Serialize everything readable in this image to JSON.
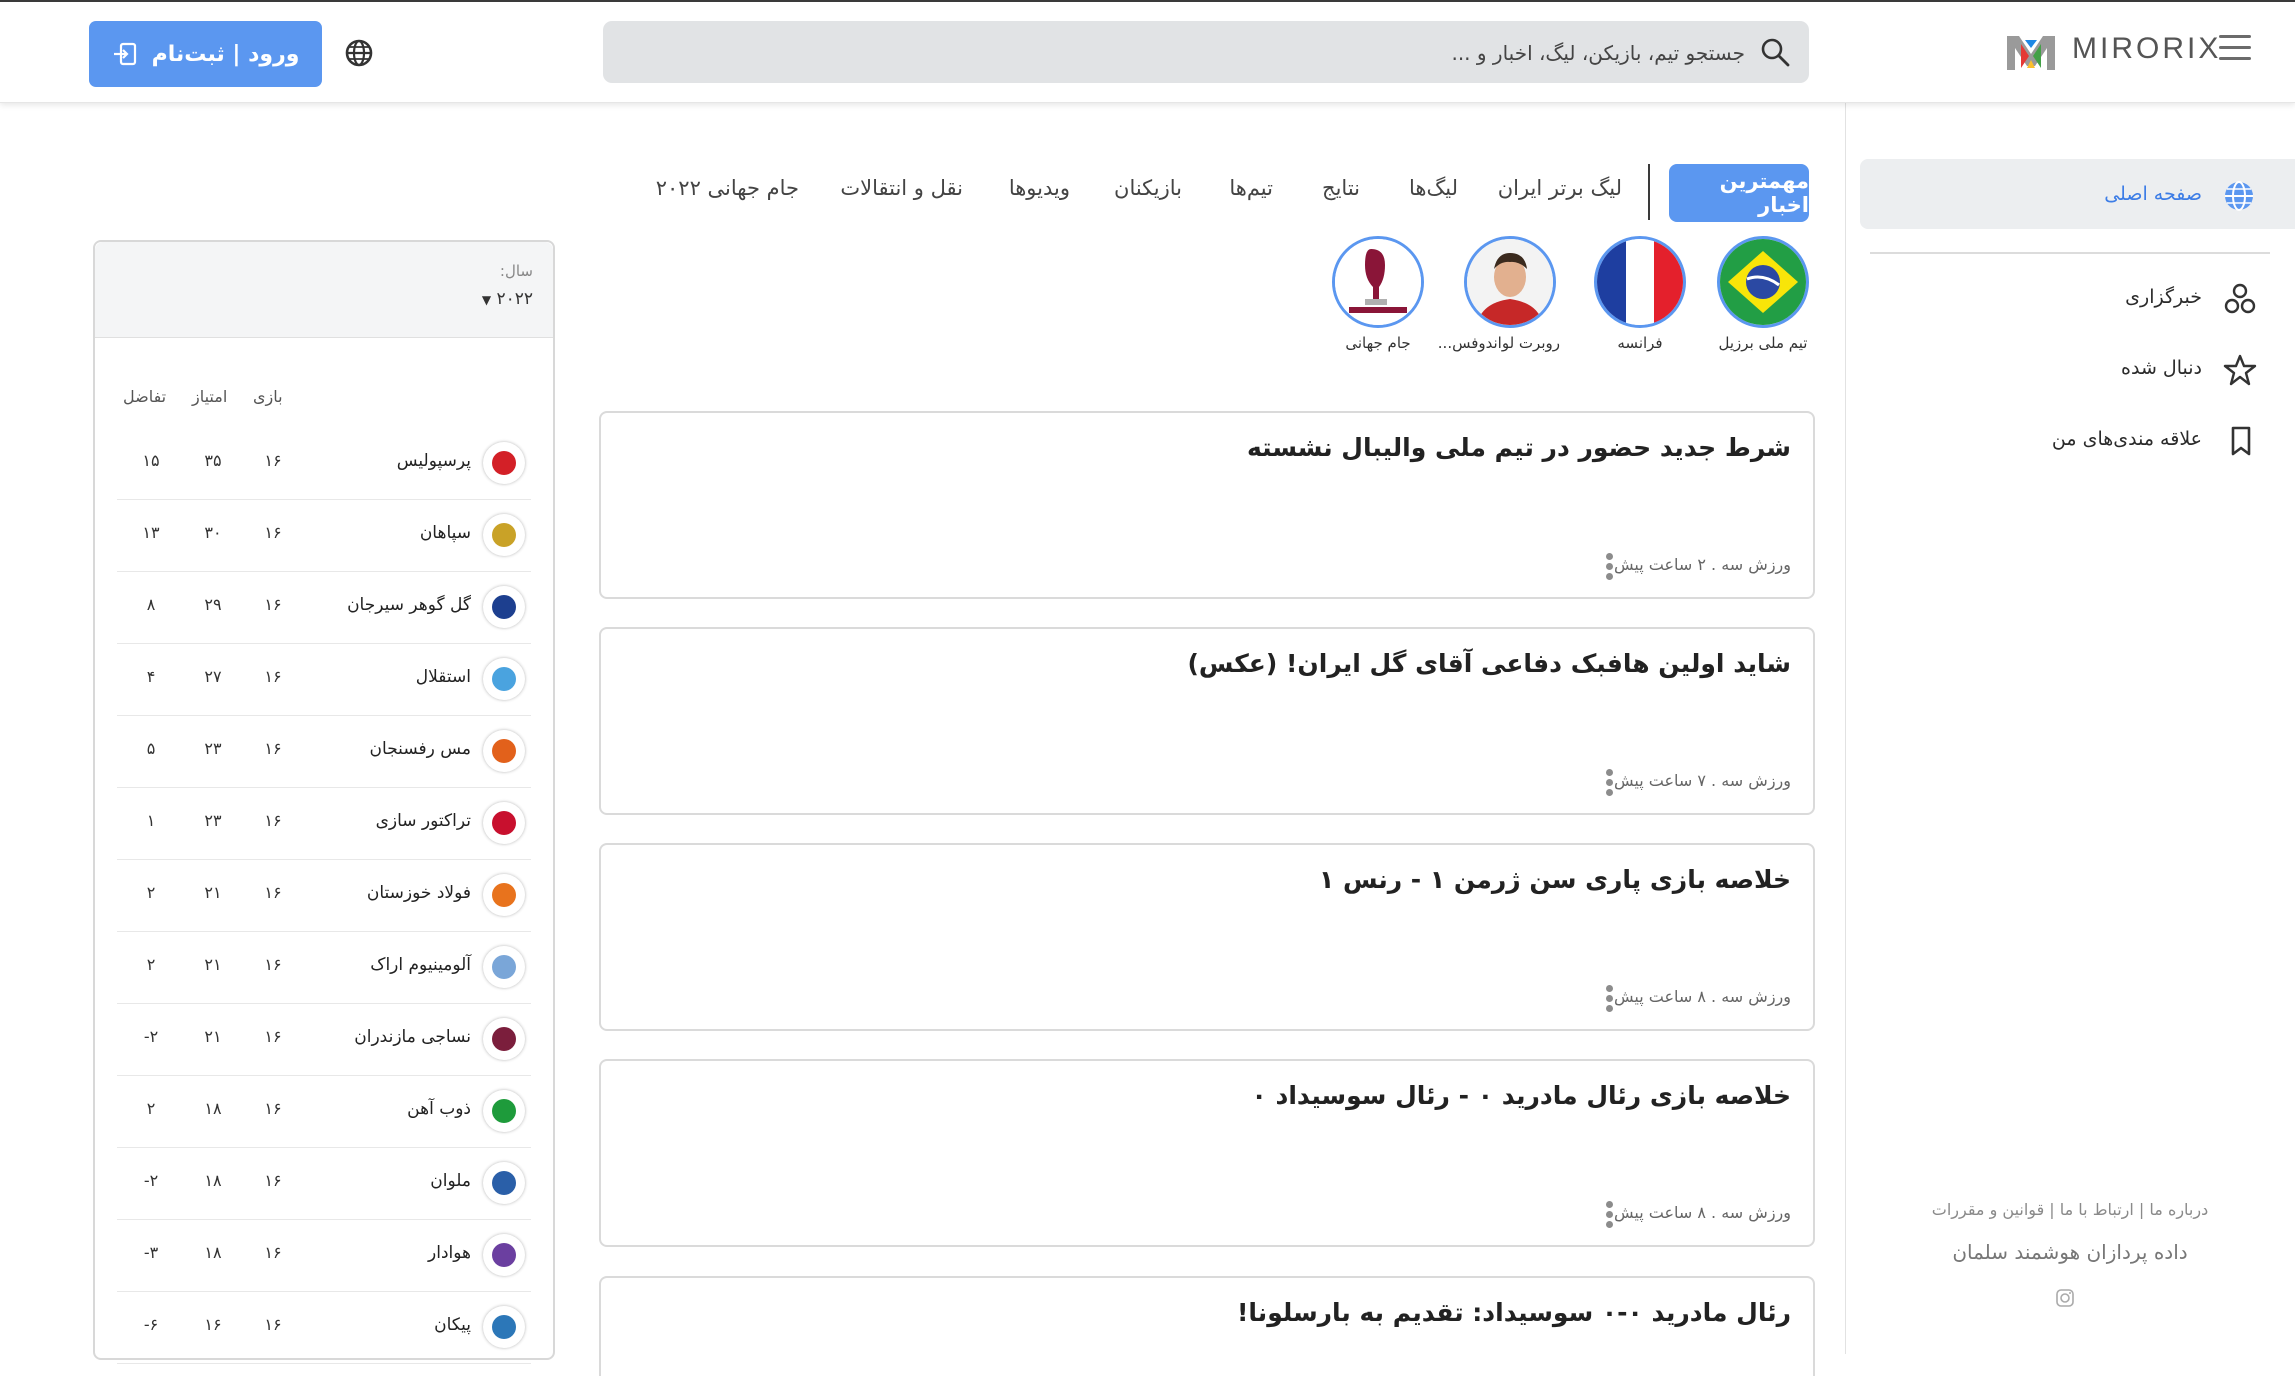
{
  "header": {
    "brand": "MIRORIX",
    "search_placeholder": "جستجو تیم، بازیکن، لیگ، اخبار و ...",
    "login_label": "ورود | ثبت‌نام"
  },
  "sidebar": {
    "items": [
      {
        "label": "صفحه اصلی",
        "icon": "globe-icon",
        "active": true
      },
      {
        "label": "خبرگزاری",
        "icon": "news-agency-icon"
      },
      {
        "label": "دنبال شده",
        "icon": "star-icon"
      },
      {
        "label": "علاقه مندی‌های من",
        "icon": "bookmark-icon"
      }
    ],
    "footer_links": "درباره ما | ارتباط با ما | قوانین و مقررات",
    "company": "داده پردازان هوشمند سلمان"
  },
  "tabs": {
    "active": "مهمترین اخبار",
    "items": [
      "لیگ برتر ایران",
      "لیگ‌ها",
      "نتایج",
      "تیم‌ها",
      "بازیکنان",
      "ویدیوها",
      "نقل و انتقالات",
      "جام جهانی ۲۰۲۲"
    ]
  },
  "topics": [
    {
      "label": "تیم ملی برزیل",
      "kind": "brazil-flag-icon"
    },
    {
      "label": "فرانسه",
      "kind": "france-flag-icon"
    },
    {
      "label": "روبرت لواندوفس...",
      "kind": "player-photo"
    },
    {
      "label": "جام جهانی",
      "kind": "world-cup-logo"
    }
  ],
  "news": [
    {
      "title": "شرط جدید حضور در تیم ملی والیبال نشسته",
      "meta": "ورزش سه . ۲ ساعت پیش"
    },
    {
      "title": "شاید اولین هافبک دفاعی آقای گل ایران! (عکس)",
      "meta": "ورزش سه . ۷ ساعت پیش"
    },
    {
      "title": "خلاصه بازی پاری سن ژرمن ۱ - رنس ۱",
      "meta": "ورزش سه . ۸ ساعت پیش"
    },
    {
      "title": "خلاصه بازی رئال مادرید ۰ - رئال سوسیداد ۰",
      "meta": "ورزش سه . ۸ ساعت پیش"
    },
    {
      "title": "رئال مادرید ۰-۰ سوسیداد: تقدیم به بارسلونا!",
      "meta": ""
    }
  ],
  "standings": {
    "year_label": "سال:",
    "year_value": "۲۰۲۲",
    "headers": {
      "played": "بازی",
      "points": "امتیاز",
      "diff": "تفاضل"
    },
    "rows": [
      {
        "team": "پرسپولیس",
        "played": "۱۶",
        "points": "۳۵",
        "diff": "۱۵",
        "color": "#d32027"
      },
      {
        "team": "سپاهان",
        "played": "۱۶",
        "points": "۳۰",
        "diff": "۱۳",
        "color": "#c9a227"
      },
      {
        "team": "گل گوهر سیرجان",
        "played": "۱۶",
        "points": "۲۹",
        "diff": "۸",
        "color": "#1d3f8f"
      },
      {
        "team": "استقلال",
        "played": "۱۶",
        "points": "۲۷",
        "diff": "۴",
        "color": "#4aa3df"
      },
      {
        "team": "مس رفسنجان",
        "played": "۱۶",
        "points": "۲۳",
        "diff": "۵",
        "color": "#e2611b"
      },
      {
        "team": "تراکتور سازی",
        "played": "۱۶",
        "points": "۲۳",
        "diff": "۱",
        "color": "#c8102e"
      },
      {
        "team": "فولاد خوزستان",
        "played": "۱۶",
        "points": "۲۱",
        "diff": "۲",
        "color": "#e8731d"
      },
      {
        "team": "آلومینیوم اراک",
        "played": "۱۶",
        "points": "۲۱",
        "diff": "۲",
        "color": "#7aa6d8"
      },
      {
        "team": "نساجی مازندران",
        "played": "۱۶",
        "points": "۲۱",
        "diff": "-۲",
        "color": "#7b1e3c"
      },
      {
        "team": "ذوب آهن",
        "played": "۱۶",
        "points": "۱۸",
        "diff": "۲",
        "color": "#1e9b3b"
      },
      {
        "team": "ملوان",
        "played": "۱۶",
        "points": "۱۸",
        "diff": "-۲",
        "color": "#2a5fa8"
      },
      {
        "team": "هوادار",
        "played": "۱۶",
        "points": "۱۸",
        "diff": "-۳",
        "color": "#6b3fa0"
      },
      {
        "team": "پیکان",
        "played": "۱۶",
        "points": "۱۶",
        "diff": "-۶",
        "color": "#2c77b8"
      }
    ]
  },
  "colors": {
    "accent": "#5b97f0",
    "sidebar_active_bg": "#eceef0",
    "search_bg": "#e1e3e5"
  }
}
